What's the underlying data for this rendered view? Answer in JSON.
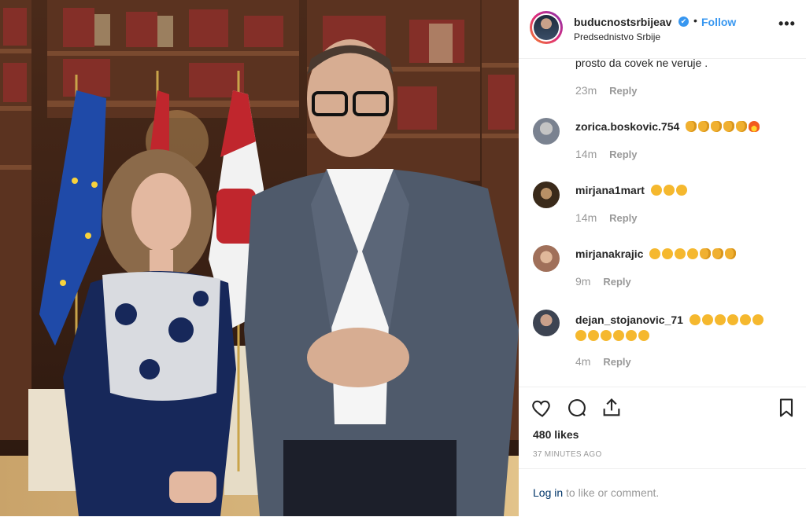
{
  "post": {
    "username": "buducnostsrbijeav",
    "verified_glyph": "✔",
    "separator": "•",
    "follow_label": "Follow",
    "location": "Predsednistvo Srbije",
    "more_label": "•••"
  },
  "comments": [
    {
      "user": "",
      "text": "prosto da covek ne veruje .",
      "time": "23m",
      "reply": "Reply",
      "emojis": []
    },
    {
      "user": "zorica.boskovic.754",
      "text": "",
      "time": "14m",
      "reply": "Reply",
      "emojis": [
        "thumbs-up-emoji",
        "thumbs-up-emoji",
        "thumbs-up-emoji",
        "thumbs-up-emoji",
        "raised-hands-emoji",
        "fire-emoji"
      ]
    },
    {
      "user": "mirjana1mart",
      "text": "",
      "time": "14m",
      "reply": "Reply",
      "emojis": [
        "clapping-hands-emoji",
        "clapping-hands-emoji",
        "clapping-hands-emoji"
      ]
    },
    {
      "user": "mirjanakrajic",
      "text": "",
      "time": "9m",
      "reply": "Reply",
      "emojis": [
        "clapping-hands-emoji",
        "clapping-hands-emoji",
        "clapping-hands-emoji",
        "clapping-hands-emoji",
        "thumbs-up-emoji",
        "thumbs-up-emoji",
        "thumbs-up-emoji"
      ]
    },
    {
      "user": "dejan_stojanovic_71",
      "text": "",
      "time": "4m",
      "reply": "Reply",
      "emojis": [
        "clapping-hands-emoji",
        "clapping-hands-emoji",
        "clapping-hands-emoji",
        "clapping-hands-emoji",
        "clapping-hands-emoji",
        "clapping-hands-emoji",
        "clapping-hands-emoji",
        "clapping-hands-emoji",
        "clapping-hands-emoji",
        "clapping-hands-emoji",
        "clapping-hands-emoji",
        "clapping-hands-emoji"
      ]
    }
  ],
  "actions": {
    "like_icon": "heart-icon",
    "comment_icon": "comment-icon",
    "share_icon": "share-icon",
    "save_icon": "bookmark-icon",
    "likes": "480 likes",
    "time_ago": "37 MINUTES AGO"
  },
  "login": {
    "link": "Log in",
    "rest": " to like or comment."
  },
  "colors": {
    "accent": "#3897f0",
    "text": "#262626",
    "muted": "#999999",
    "border": "#efefef",
    "link_dark": "#003569"
  }
}
